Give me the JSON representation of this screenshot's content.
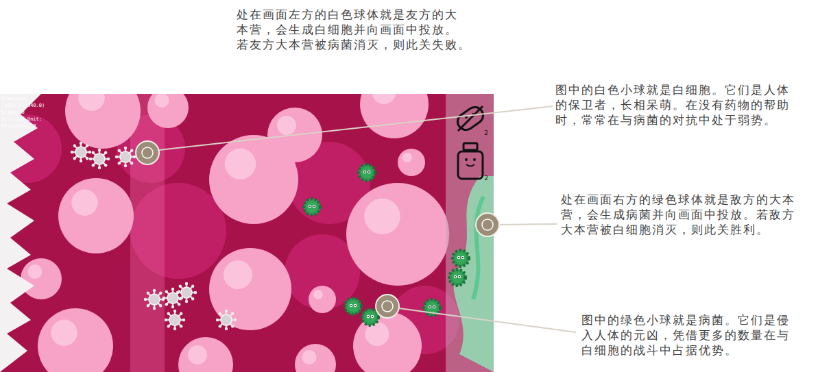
{
  "annotations": {
    "home_base": [
      "处在画面左方的白色球体就是友方的大",
      "本营，会生成白细胞并向画面中投放。",
      "若友方大本营被病菌消灭，则此关失败。"
    ],
    "white_cell": [
      "图中的白色小球就是白细胞。它们是人体",
      "的保卫者，长相呆萌。在没有药物的帮助",
      "时，常常在与病菌的对抗中处于弱势。"
    ],
    "enemy_base": [
      "处在画面右方的绿色球体就是敌方的大本",
      "营，会生成病菌并向画面中投放。若敌方",
      "大本营被白细胞消灭，则此关胜利。"
    ],
    "bacteria": [
      "图中的绿色小球就是病菌。它们是侵",
      "入人体的元凶，凭借更多的数量在与",
      "白细胞的战斗中占据优势。"
    ]
  },
  "debug": [
    "drawLine:",
    "(1811.0, 340.0)",
    "Stage: 0",
    "Selected Unit:",
    "Positions: 0"
  ],
  "tools": [
    {
      "kind": "pill",
      "count": "2"
    },
    {
      "kind": "bottle",
      "count": "2"
    }
  ]
}
